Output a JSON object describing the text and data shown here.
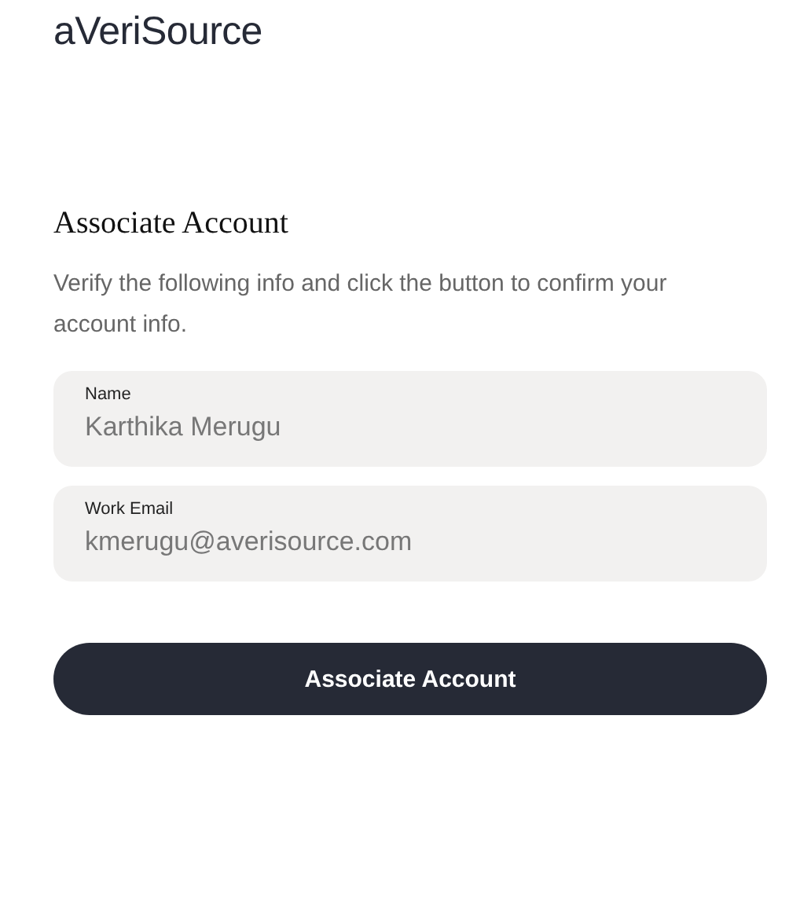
{
  "logo": "aVeriSource",
  "heading": "Associate Account",
  "description": "Verify the following info and click the button to confirm your account info.",
  "fields": [
    {
      "label": "Name",
      "value": "Karthika Merugu"
    },
    {
      "label": "Work Email",
      "value": "kmerugu@averisource.com"
    }
  ],
  "button": "Associate Account"
}
